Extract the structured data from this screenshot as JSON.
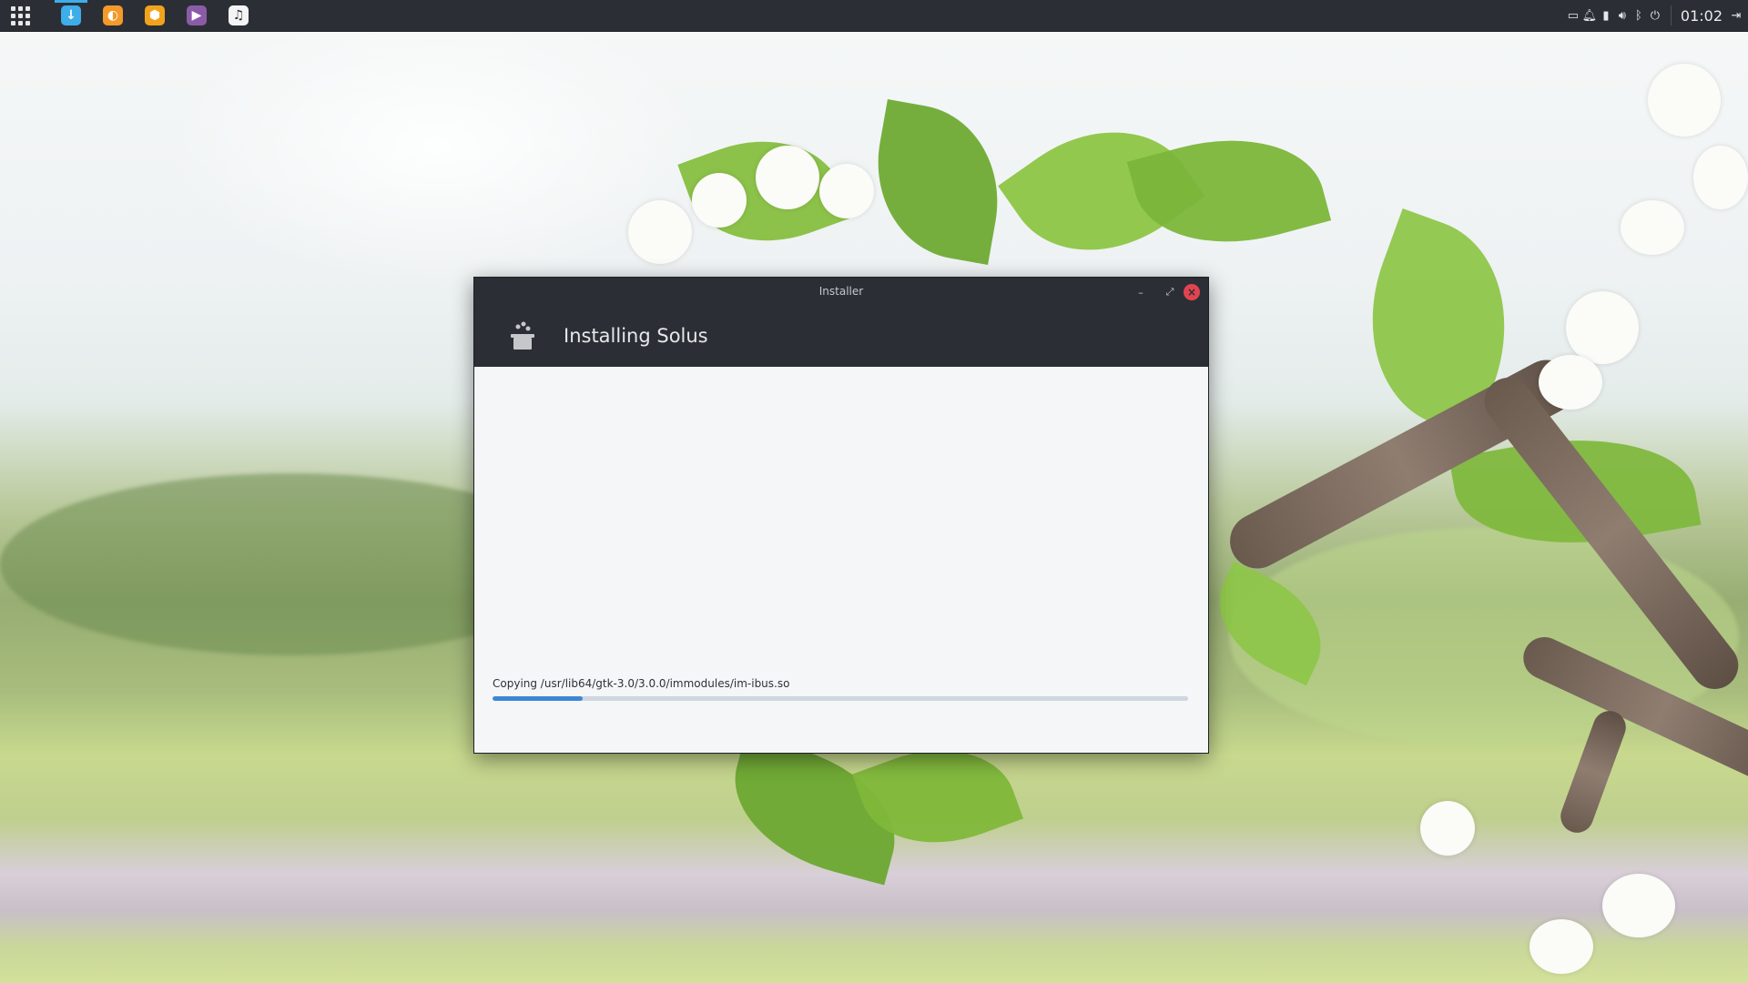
{
  "panel": {
    "tasks": [
      {
        "name": "installer-task",
        "glyph": "↓",
        "color": "#3daee9",
        "active": true
      },
      {
        "name": "firefox-task",
        "glyph": "◐",
        "color": "#f39a2a",
        "active": false
      },
      {
        "name": "hexchat-task",
        "glyph": "⬢",
        "color": "#f2a31b",
        "active": false
      },
      {
        "name": "gnome-mpv-task",
        "glyph": "▶",
        "color": "#8a5ca7",
        "active": false
      },
      {
        "name": "rhythmbox-task",
        "glyph": "♫",
        "color": "#f4f4f4",
        "active": false
      }
    ],
    "clock": "01:02"
  },
  "window": {
    "title": "Installer",
    "header": "Installing Solus",
    "status": "Copying /usr/lib64/gtk-3.0/3.0.0/immodules/im-ibus.so",
    "progress_percent": 13
  },
  "colors": {
    "panel_bg": "#2b2f35",
    "accent": "#3d87d4",
    "close": "#e0454f"
  }
}
